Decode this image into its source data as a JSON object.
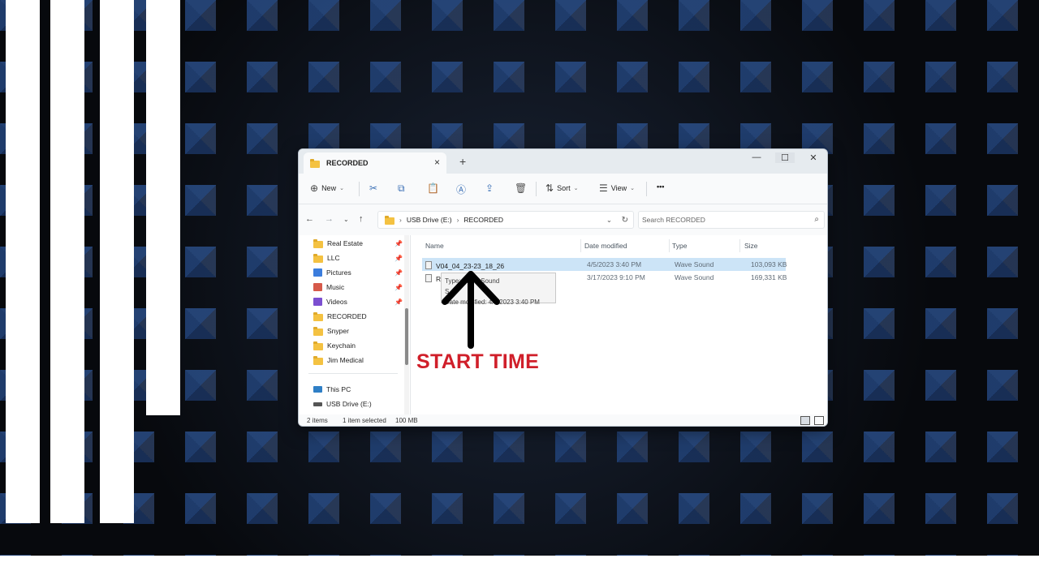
{
  "window": {
    "tab_title": "RECORDED",
    "controls": {
      "minimize": "—",
      "maximize": "☐",
      "close": "✕"
    }
  },
  "toolbar": {
    "new_label": "New",
    "sort_label": "Sort",
    "view_label": "View",
    "more_label": "•••"
  },
  "address": {
    "crumbs": [
      "USB Drive (E:)",
      "RECORDED"
    ],
    "search_placeholder": "Search RECORDED"
  },
  "sidebar": {
    "quick_access": [
      {
        "label": "Real Estate",
        "icon": "folder-icon",
        "pinned": true
      },
      {
        "label": "LLC",
        "icon": "folder-icon",
        "pinned": true
      },
      {
        "label": "Pictures",
        "icon": "pictures-icon",
        "pinned": true
      },
      {
        "label": "Music",
        "icon": "music-icon",
        "pinned": true
      },
      {
        "label": "Videos",
        "icon": "videos-icon",
        "pinned": true
      },
      {
        "label": "RECORDED",
        "icon": "folder-icon",
        "pinned": false
      },
      {
        "label": "Snyper",
        "icon": "folder-icon",
        "pinned": false
      },
      {
        "label": "Keychain",
        "icon": "folder-icon",
        "pinned": false
      },
      {
        "label": "Jim Medical",
        "icon": "folder-icon",
        "pinned": false
      }
    ],
    "this_pc": "This PC",
    "usb_drive": "USB Drive (E:)"
  },
  "table": {
    "columns": [
      "Name",
      "Date modified",
      "Type",
      "Size"
    ],
    "rows": [
      {
        "name": "V04_04_23-23_18_26",
        "date": "4/5/2023 3:40 PM",
        "type": "Wave Sound",
        "size": "103,093 KB",
        "selected": true
      },
      {
        "name": "RE..._07",
        "date": "3/17/2023 9:10 PM",
        "type": "Wave Sound",
        "size": "169,331 KB",
        "selected": false
      }
    ]
  },
  "tooltip": {
    "line1": "Type: Wave Sound",
    "line2": "S...",
    "line3": "Date modified: 4/5/2023 3:40 PM"
  },
  "status": {
    "items": "2 items",
    "selected": "1 item selected",
    "size": "100 MB"
  },
  "annotation": {
    "text": "START TIME",
    "color": "#d01f2a"
  }
}
